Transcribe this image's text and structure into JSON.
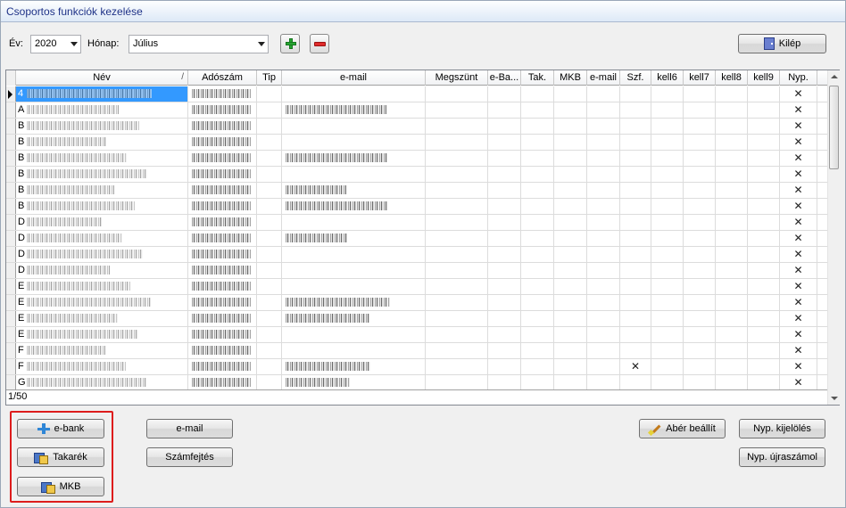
{
  "window": {
    "title": "Csoportos funkciók kezelése"
  },
  "toolbar": {
    "year_label": "Év:",
    "year_value": "2020",
    "month_label": "Hónap:",
    "month_value": "Július",
    "exit_label": "Kilép"
  },
  "grid": {
    "columns": [
      "Név",
      "Adószám",
      "Tip",
      "e-mail",
      "Megszünt",
      "e-Ba...",
      "Tak.",
      "MKB",
      "e-mail",
      "Szf.",
      "kell6",
      "kell7",
      "kell8",
      "kell9",
      "Nyp."
    ],
    "rows": [
      {
        "initial": "4",
        "szf": "",
        "nyp": "✕"
      },
      {
        "initial": "A",
        "szf": "",
        "nyp": "✕"
      },
      {
        "initial": "B",
        "szf": "",
        "nyp": "✕"
      },
      {
        "initial": "B",
        "szf": "",
        "nyp": "✕"
      },
      {
        "initial": "B",
        "szf": "",
        "nyp": "✕"
      },
      {
        "initial": "B",
        "szf": "",
        "nyp": "✕"
      },
      {
        "initial": "B",
        "szf": "",
        "nyp": "✕"
      },
      {
        "initial": "B",
        "szf": "",
        "nyp": "✕"
      },
      {
        "initial": "D",
        "szf": "",
        "nyp": "✕"
      },
      {
        "initial": "D",
        "szf": "",
        "nyp": "✕"
      },
      {
        "initial": "D",
        "szf": "",
        "nyp": "✕"
      },
      {
        "initial": "D",
        "szf": "",
        "nyp": "✕"
      },
      {
        "initial": "E",
        "szf": "",
        "nyp": "✕"
      },
      {
        "initial": "E",
        "szf": "",
        "nyp": "✕"
      },
      {
        "initial": "E",
        "szf": "",
        "nyp": "✕"
      },
      {
        "initial": "E",
        "szf": "",
        "nyp": "✕"
      },
      {
        "initial": "F",
        "szf": "",
        "nyp": "✕"
      },
      {
        "initial": "F",
        "szf": "✕",
        "nyp": "✕"
      },
      {
        "initial": "G",
        "szf": "",
        "nyp": "✕"
      }
    ],
    "record_counter": "1/50"
  },
  "buttons": {
    "ebank": "e-bank",
    "takarek": "Takarék",
    "mkb": "MKB",
    "email": "e-mail",
    "szamfejtes": "Számfejtés",
    "aber": "Abér beállít",
    "nyp_kijeloles": "Nyp. kijelölés",
    "nyp_ujraszamol": "Nyp. újraszámol"
  }
}
